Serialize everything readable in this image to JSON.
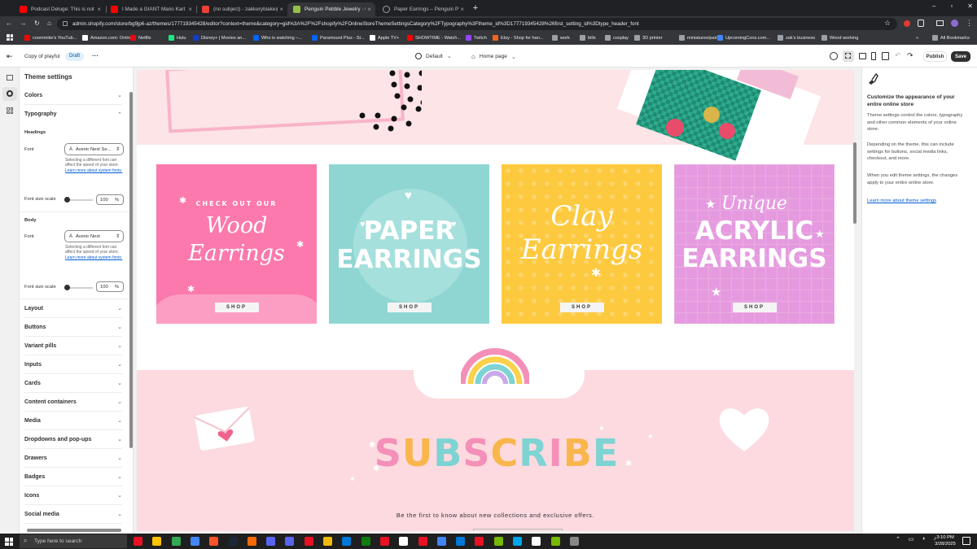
{
  "browser": {
    "tabs": [
      {
        "title": "Podcast Deluge: This is not a p",
        "fav": "#ff0000"
      },
      {
        "title": "I Made a GIANT Mario Kart Cir",
        "fav": "#ff0000"
      },
      {
        "title": "(no subject) - zakkerybiake@gm",
        "fav": "#ea4335"
      },
      {
        "title": "Penguin Pebble Jewelry · Custo",
        "fav": "#95bf47"
      },
      {
        "title": "Paper Earrings – Penguin Pebble",
        "fav": "#9aa0a6"
      }
    ],
    "url": "admin.shopify.com/store/bg9jp6-az/themes/177719345428/editor?context=theme&category=gid%3A%2F%2Fshopify%2FOnlineStoreThemeSettingsCategory%2FTypography%3Ftheme_id%3D177719345428%26first_setting_id%3Dtype_header_font",
    "bookmarks": [
      {
        "label": "coommike's YouTub...",
        "color": "#ff0000"
      },
      {
        "label": "Amazon.com: Onlin...",
        "color": "#ffffff"
      },
      {
        "label": "Netflix",
        "color": "#e50914"
      },
      {
        "label": "Hulu",
        "color": "#1ce783"
      },
      {
        "label": "Disney+ | Movies an...",
        "color": "#113ccf"
      },
      {
        "label": "Who is watching –...",
        "color": "#0064ff"
      },
      {
        "label": "Paramount Plus - St...",
        "color": "#0064ff"
      },
      {
        "label": "Apple TV+",
        "color": "#ffffff"
      },
      {
        "label": "SHOWTIME - Watch...",
        "color": "#ff0000"
      },
      {
        "label": "Twitch",
        "color": "#9146ff"
      },
      {
        "label": "Etsy - Shop for han...",
        "color": "#f1641e"
      },
      {
        "label": "work",
        "color": "#9aa0a6"
      },
      {
        "label": "bills",
        "color": "#9aa0a6"
      },
      {
        "label": "cosplay",
        "color": "#9aa0a6"
      },
      {
        "label": "3D printer",
        "color": "#9aa0a6"
      },
      {
        "label": "miniatures/paint",
        "color": "#9aa0a6"
      },
      {
        "label": "UpcomingCons.com...",
        "color": "#4285f4"
      },
      {
        "label": "zak's business",
        "color": "#9aa0a6"
      },
      {
        "label": "Wood working",
        "color": "#9aa0a6"
      }
    ],
    "all_bookmarks": "All Bookmarks"
  },
  "topbar": {
    "theme_name": "Copy of playful",
    "badge": "Draft",
    "more": "···",
    "device": "Default",
    "page": "Home page",
    "publish": "Publish",
    "save": "Save"
  },
  "panel": {
    "title": "Theme settings",
    "sections_top": [
      "Colors",
      "Typography"
    ],
    "headings_label": "Headings",
    "body_label": "Body",
    "font_label": "Font",
    "heading_font": "Avenir Next Se...",
    "body_font": "Avenir Next",
    "font_help": "Selecting a different font can affect the speed of your store.",
    "font_help_link": "Learn more about system fonts.",
    "scale_label": "Font size scale",
    "heading_scale": "100",
    "body_scale": "100",
    "unit": "%",
    "sections_bottom": [
      "Layout",
      "Buttons",
      "Variant pills",
      "Inputs",
      "Cards",
      "Content containers",
      "Media",
      "Dropdowns and pop-ups",
      "Drawers",
      "Badges",
      "Icons",
      "Social media"
    ]
  },
  "preview": {
    "cards": [
      {
        "line1": "CHECK OUT OUR",
        "line2": "Wood",
        "line3": "Earrings",
        "shop": "SHOP",
        "bg": "#fb79ad"
      },
      {
        "line1": "",
        "line2": "PAPER",
        "line3": "EARRINGS",
        "shop": "SHOP",
        "bg": "#8fd6d3"
      },
      {
        "line1": "",
        "line2": "Clay",
        "line3": "Earrings",
        "shop": "SHOP",
        "bg": "#fdc93f"
      },
      {
        "line1": "Unique",
        "line2": "ACRYLIC",
        "line3": "EARRINGS",
        "shop": "SHOP",
        "bg": "#e59ae0"
      }
    ],
    "subscribe_letters": [
      {
        "ch": "S",
        "color": "#f48fb8"
      },
      {
        "ch": "U",
        "color": "#f9b64c"
      },
      {
        "ch": "B",
        "color": "#7ed3d3"
      },
      {
        "ch": "S",
        "color": "#f48fb8"
      },
      {
        "ch": "C",
        "color": "#f9b64c"
      },
      {
        "ch": "R",
        "color": "#7ed3d3"
      },
      {
        "ch": "I",
        "color": "#f48fb8"
      },
      {
        "ch": "B",
        "color": "#f9b64c"
      },
      {
        "ch": "E",
        "color": "#7ed3d3"
      }
    ],
    "subscribe_text": "Be the first to know about new collections and exclusive offers."
  },
  "help_panel": {
    "title": "Customize the appearance of your entire online store",
    "p1": "Theme settings control the colors, typography and other common elements of your online store.",
    "p2": "Depending on the theme, this can include settings for buttons, social media links, checkout, and more.",
    "p3": "When you edit theme settings, the changes apply to your entire online store.",
    "link": "Learn more about theme settings"
  },
  "taskbar": {
    "search": "Type here to search",
    "time": "3:10 PM",
    "date": "3/28/2025"
  }
}
